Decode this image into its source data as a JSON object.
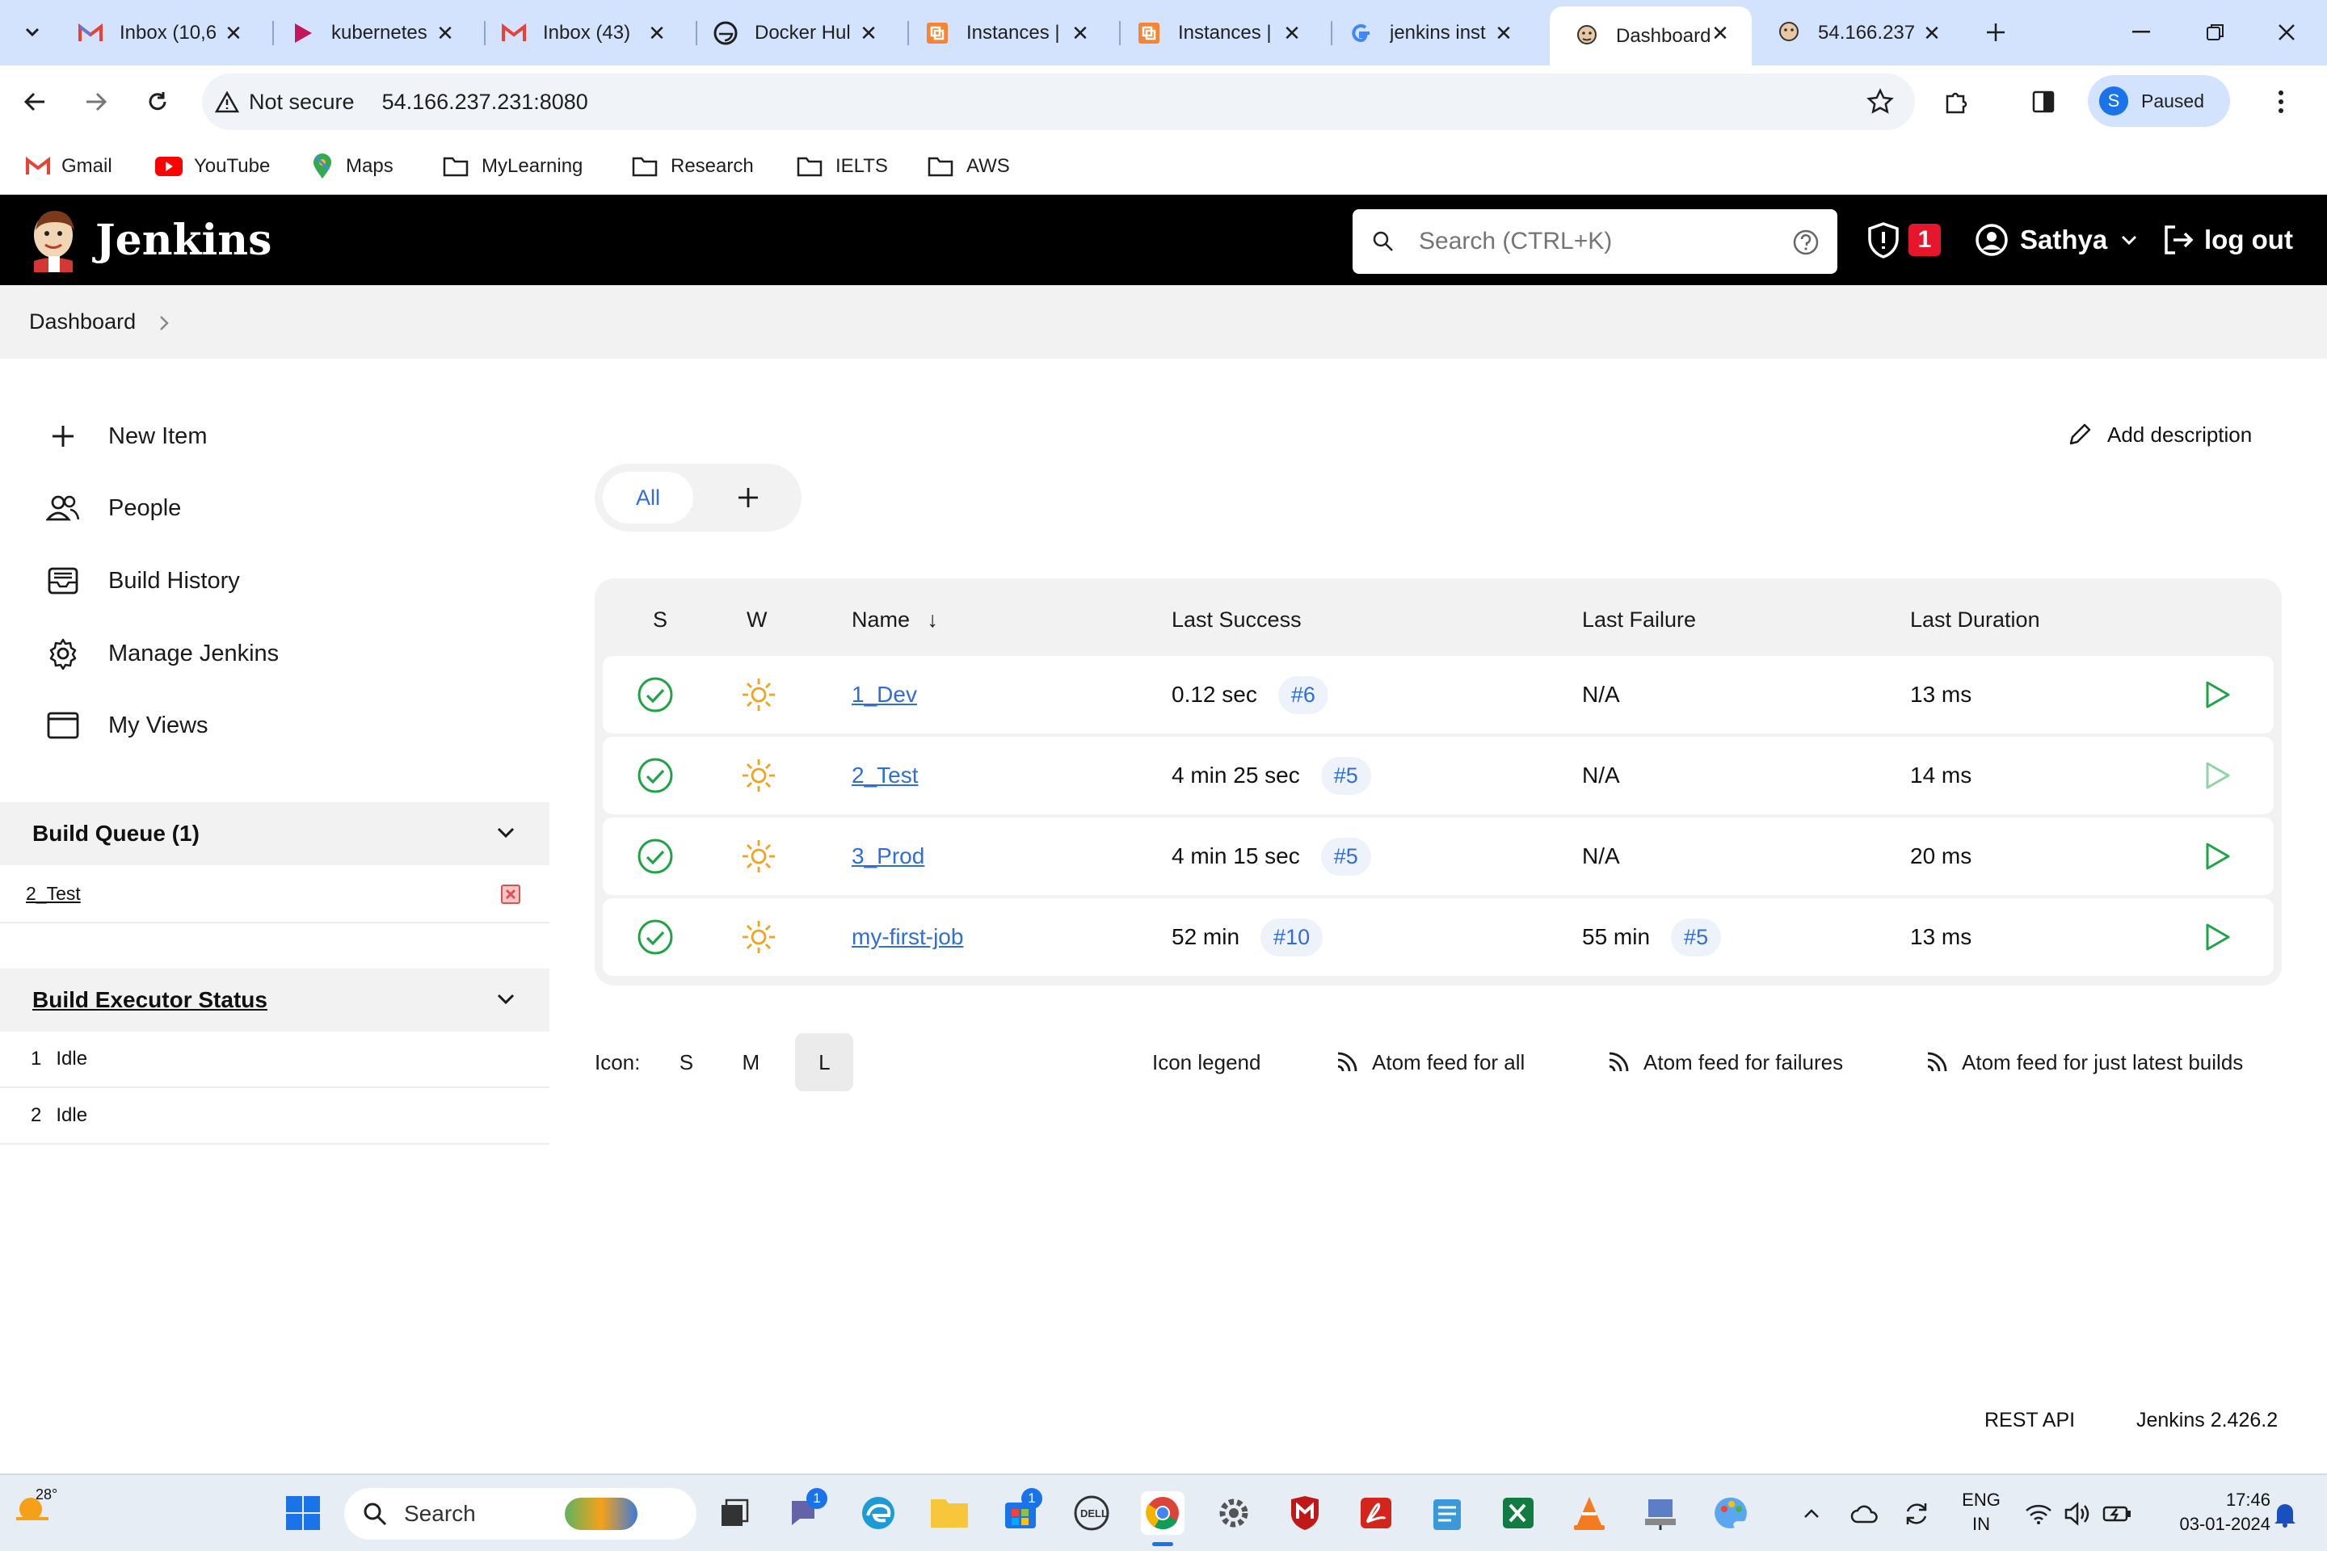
{
  "browser": {
    "tabs": [
      {
        "title": "Inbox (10,6",
        "icon": "gmail-icon"
      },
      {
        "title": "kubernetes",
        "icon": "video-play-icon"
      },
      {
        "title": "Inbox (43)",
        "icon": "gmail-icon"
      },
      {
        "title": "Docker Hul",
        "icon": "docker-icon"
      },
      {
        "title": "Instances |",
        "icon": "aws-icon"
      },
      {
        "title": "Instances |",
        "icon": "aws-icon"
      },
      {
        "title": "jenkins inst",
        "icon": "google-icon"
      },
      {
        "title": "Dashboard",
        "icon": "jenkins-icon"
      },
      {
        "title": "54.166.237",
        "icon": "jenkins-icon"
      }
    ],
    "active_tab": 7,
    "security_label": "Not secure",
    "url": "54.166.237.231:8080",
    "profile_initial": "S",
    "profile_status": "Paused",
    "bookmarks": [
      "Gmail",
      "YouTube",
      "Maps",
      "MyLearning",
      "Research",
      "IELTS",
      "AWS"
    ]
  },
  "jenkins": {
    "brand": "Jenkins",
    "search_placeholder": "Search (CTRL+K)",
    "security_count": "1",
    "user": "Sathya",
    "logout": "log out",
    "breadcrumb": "Dashboard",
    "sidebar": [
      "New Item",
      "People",
      "Build History",
      "Manage Jenkins",
      "My Views"
    ],
    "build_queue": {
      "title": "Build Queue (1)",
      "items": [
        "2_Test"
      ]
    },
    "executors": {
      "title": "Build Executor Status",
      "rows": [
        {
          "num": "1",
          "status": "Idle"
        },
        {
          "num": "2",
          "status": "Idle"
        }
      ]
    },
    "add_description": "Add description",
    "view_tab": "All",
    "columns": {
      "s": "S",
      "w": "W",
      "name": "Name",
      "sort_arrow": "↓",
      "last_success": "Last Success",
      "last_failure": "Last Failure",
      "last_duration": "Last Duration"
    },
    "jobs": [
      {
        "name": "1_Dev",
        "success": "0.12 sec",
        "success_build": "#6",
        "failure": "N/A",
        "failure_build": "",
        "duration": "13 ms"
      },
      {
        "name": "2_Test",
        "success": "4 min 25 sec",
        "success_build": "#5",
        "failure": "N/A",
        "failure_build": "",
        "duration": "14 ms"
      },
      {
        "name": "3_Prod",
        "success": "4 min 15 sec",
        "success_build": "#5",
        "failure": "N/A",
        "failure_build": "",
        "duration": "20 ms"
      },
      {
        "name": "my-first-job",
        "success": "52 min",
        "success_build": "#10",
        "failure": "55 min",
        "failure_build": "#5",
        "duration": "13 ms"
      }
    ],
    "icon_label": "Icon:",
    "icon_sizes": [
      "S",
      "M",
      "L"
    ],
    "icon_size_selected": "L",
    "legend": "Icon legend",
    "feeds": [
      "Atom feed for all",
      "Atom feed for failures",
      "Atom feed for just latest builds"
    ],
    "rest_api": "REST API",
    "version": "Jenkins 2.426.2"
  },
  "taskbar": {
    "weather": "28°",
    "search": "Search",
    "lang1": "ENG",
    "lang2": "IN",
    "time": "17:46",
    "date": "03-01-2024",
    "teams_badge": "1",
    "store_badge": "1"
  },
  "colors": {
    "success": "#1ea446",
    "link": "#2e6ddb",
    "sun": "#f2a31b",
    "alert": "#e6162d"
  }
}
